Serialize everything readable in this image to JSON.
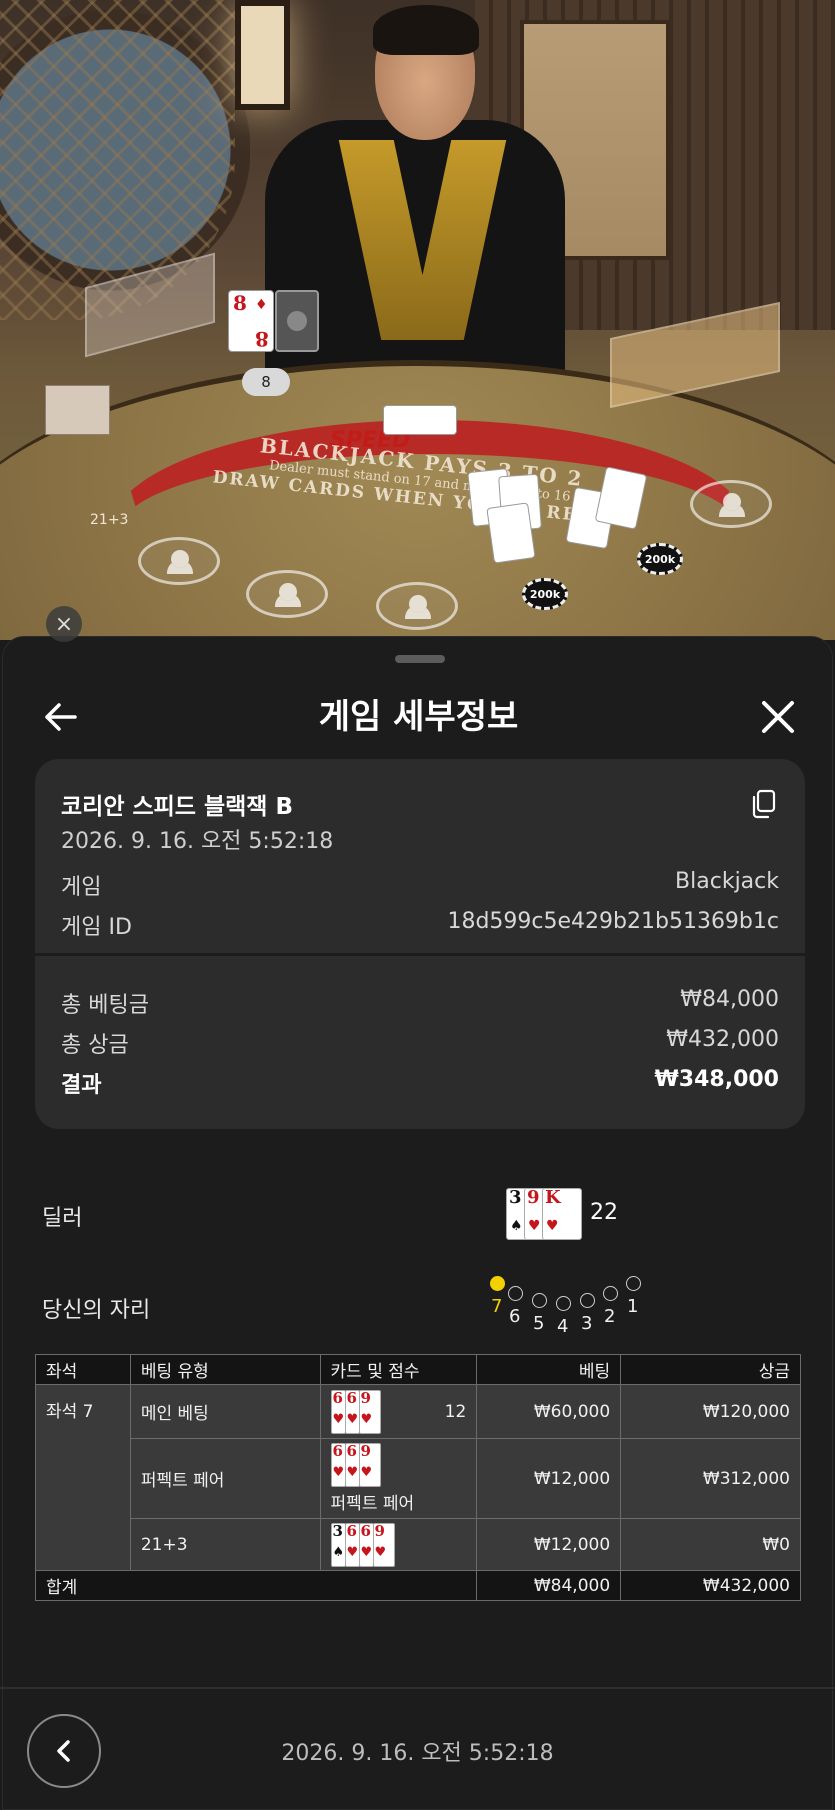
{
  "video": {
    "felt_line1": "BLACKJACK PAYS 3 TO 2",
    "felt_line2": "Dealer must stand on 17 and must draw to 16",
    "felt_line3": "DRAW CARDS WHEN YOU'RE READY",
    "logo": "SPEED",
    "dealer_score": "8",
    "chip_left": "200k",
    "chip_right": "200k",
    "side_bet_left": "21+3",
    "dealer_card": {
      "rank": "8",
      "suit": "♦"
    }
  },
  "sheet": {
    "title": "게임 세부정보",
    "game_name": "코리안 스피드 블랙잭 B",
    "game_time": "2026. 9. 16. 오전 5:52:18",
    "details": [
      {
        "label": "게임",
        "value": "Blackjack"
      },
      {
        "label": "게임 ID",
        "value": "18d599c5e429b21b51369b1c"
      }
    ],
    "totals": [
      {
        "label": "총 베팅금",
        "value": "₩84,000"
      },
      {
        "label": "총 상금",
        "value": "₩432,000"
      },
      {
        "label": "결과",
        "value": "₩348,000"
      }
    ],
    "dealer_label": "딜러",
    "dealer_cards": [
      {
        "rank": "3",
        "suit": "♠",
        "color": "black"
      },
      {
        "rank": "9",
        "suit": "♥",
        "color": "red"
      },
      {
        "rank": "K",
        "suit": "♥",
        "color": "red"
      }
    ],
    "dealer_score": "22",
    "seat_label": "당신의 자리",
    "seats": [
      "7",
      "6",
      "5",
      "4",
      "3",
      "2",
      "1"
    ],
    "active_seat": "7",
    "table": {
      "headers": [
        "좌석",
        "베팅 유형",
        "카드 및 점수",
        "베팅",
        "상금"
      ],
      "seat": "좌석 7",
      "rows": [
        {
          "type": "메인 베팅",
          "cards": [
            {
              "rank": "6",
              "suit": "♥",
              "color": "red"
            },
            {
              "rank": "6",
              "suit": "♥",
              "color": "red"
            },
            {
              "rank": "9",
              "suit": "♥",
              "color": "red"
            }
          ],
          "score": "12",
          "extra": "",
          "bet": "₩60,000",
          "win": "₩120,000"
        },
        {
          "type": "퍼펙트 페어",
          "cards": [
            {
              "rank": "6",
              "suit": "♥",
              "color": "red"
            },
            {
              "rank": "6",
              "suit": "♥",
              "color": "red"
            },
            {
              "rank": "9",
              "suit": "♥",
              "color": "red"
            }
          ],
          "score": "",
          "extra": "퍼펙트 페어",
          "bet": "₩12,000",
          "win": "₩312,000"
        },
        {
          "type": "21+3",
          "cards": [
            {
              "rank": "3",
              "suit": "♠",
              "color": "black"
            },
            {
              "rank": "6",
              "suit": "♥",
              "color": "red"
            },
            {
              "rank": "6",
              "suit": "♥",
              "color": "red"
            },
            {
              "rank": "9",
              "suit": "♥",
              "color": "red"
            }
          ],
          "score": "",
          "extra": "",
          "bet": "₩12,000",
          "win": "₩0"
        }
      ],
      "footer": {
        "label": "합계",
        "bet": "₩84,000",
        "win": "₩432,000"
      }
    },
    "footer_time": "2026. 9. 16. 오전 5:52:18"
  }
}
